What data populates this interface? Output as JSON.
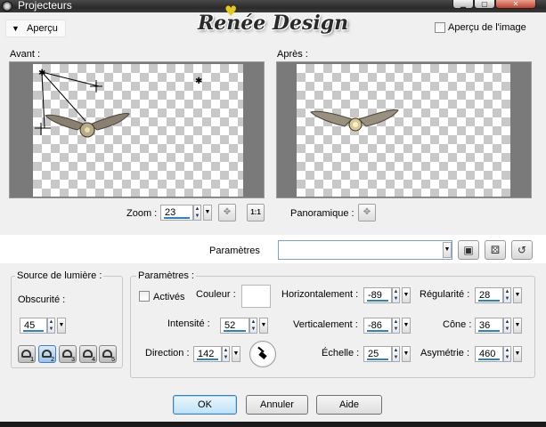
{
  "window": {
    "title": "Projecteurs",
    "watermark": "Renée Design"
  },
  "header": {
    "apercu_label": "Aperçu",
    "apercu_image_label": "Aperçu de l'image",
    "apercu_image_checked": false
  },
  "preview": {
    "before_label": "Avant :",
    "after_label": "Après :",
    "zoom_label": "Zoom :",
    "zoom_value": "23",
    "pan_label": "Panoramique :"
  },
  "presets": {
    "label": "Paramètres",
    "selected": ""
  },
  "light_source": {
    "group_title": "Source de lumière :",
    "darkness_label": "Obscurité :",
    "darkness_value": "45",
    "lights": [
      {
        "num": "1",
        "active": false
      },
      {
        "num": "2",
        "active": true
      },
      {
        "num": "3",
        "active": false
      },
      {
        "num": "4",
        "active": false
      },
      {
        "num": "5",
        "active": false
      }
    ]
  },
  "parameters": {
    "group_title": "Paramètres :",
    "active_label": "Activés",
    "active_checked": false,
    "color_label": "Couleur :",
    "color_value": "#ffffff",
    "intensity_label": "Intensité :",
    "intensity_value": "52",
    "direction_label": "Direction :",
    "direction_value": "142",
    "horizontal_label": "Horizontalement :",
    "horizontal_value": "-89",
    "vertical_label": "Verticalement :",
    "vertical_value": "-86",
    "scale_label": "Échelle :",
    "scale_value": "25",
    "regularity_label": "Régularité :",
    "regularity_value": "28",
    "cone_label": "Cône :",
    "cone_value": "36",
    "asymmetry_label": "Asymétrie :",
    "asymmetry_value": "460"
  },
  "buttons": {
    "ok": "OK",
    "cancel": "Annuler",
    "help": "Aide"
  }
}
